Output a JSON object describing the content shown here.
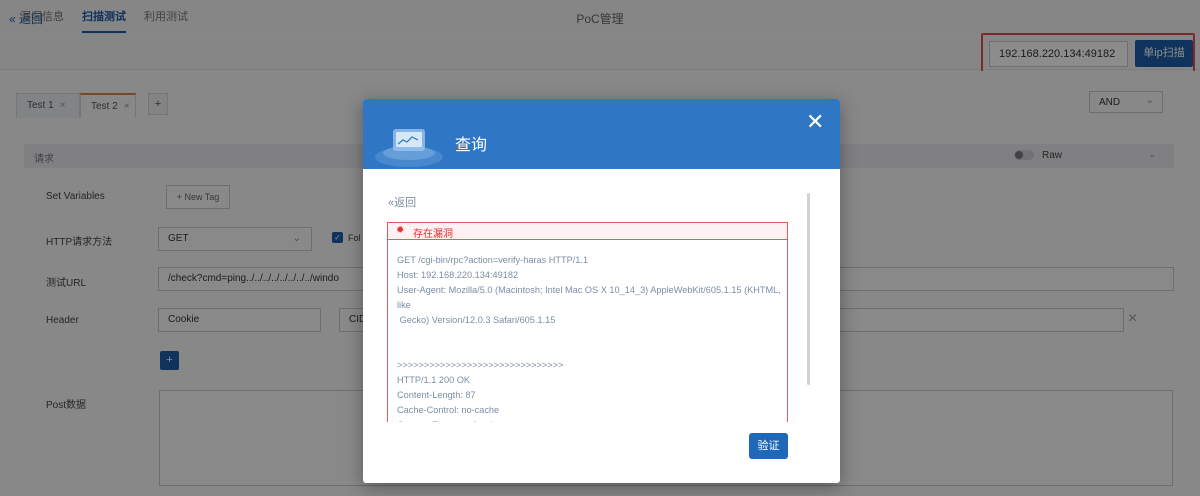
{
  "header": {
    "back_label": "« 返回",
    "title": "PoC管理"
  },
  "tabs": [
    {
      "label": "漏洞信息"
    },
    {
      "label": "扫描测试"
    },
    {
      "label": "利用测试"
    }
  ],
  "scan": {
    "ip_value": "192.168.220.134:49182",
    "button_label": "单ip扫描"
  },
  "test_tabs": [
    {
      "label": "Test 1"
    },
    {
      "label": "Test 2"
    }
  ],
  "add_tab_label": "+",
  "logic_select": {
    "value": "AND"
  },
  "request": {
    "section_label": "请求",
    "raw_label": "Raw",
    "set_variables_label": "Set Variables",
    "new_tag_label": "+ New Tag",
    "method_label": "HTTP请求方法",
    "method_value": "GET",
    "follow_label": "Fol",
    "url_label": "测试URL",
    "url_value": "/check?cmd=ping../../../../../../../../windo",
    "header_label": "Header",
    "header_key": "Cookie",
    "header_value": "CID",
    "post_label": "Post数据"
  },
  "modal": {
    "title": "查询",
    "back_label": "«返回",
    "status_label": "存在漏洞",
    "result_text": "GET /cgi-bin/rpc?action=verify-haras HTTP/1.1\nHost: 192.168.220.134:49182\nUser-Agent: Mozilla/5.0 (Macintosh; Intel Mac OS X 10_14_3) AppleWebKit/605.1.15 (KHTML, like\n Gecko) Version/12.0.3 Safari/605.1.15\n\n\n>>>>>>>>>>>>>>>>>>>>>>>>>>>>>>>\nHTTP/1.1 200 OK\nContent-Length: 87\nCache-Control: no-cache\nContent-Type: text/html",
    "verify_label": "验证"
  },
  "colors": {
    "primary": "#1d5ea8",
    "modal_header": "#2f77c5",
    "alert_red": "#e24b4b"
  },
  "icons": {
    "close": "close-icon",
    "bug": "bug-icon",
    "chevron": "chevron-down-icon",
    "check": "check-icon",
    "plus": "plus-icon",
    "modal_header_art": "search-dashboard-icon"
  }
}
